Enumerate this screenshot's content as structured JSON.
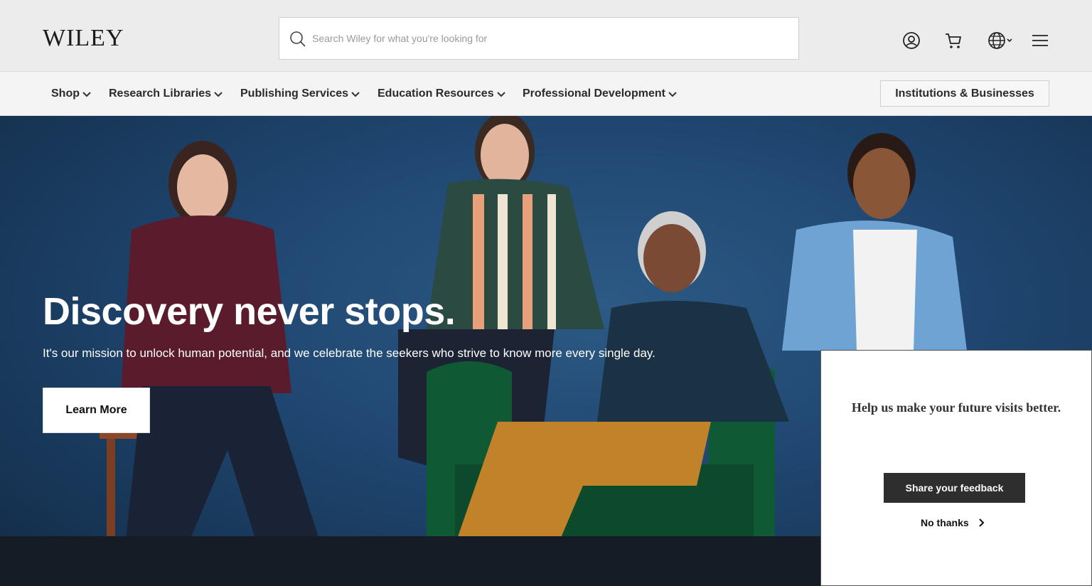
{
  "header": {
    "logo_text": "WILEY",
    "search": {
      "placeholder": "Search Wiley for what you're looking for",
      "value": ""
    },
    "icons": [
      "search-icon",
      "account-icon",
      "cart-icon",
      "globe-icon",
      "menu-icon"
    ]
  },
  "nav": {
    "items": [
      {
        "label": "Shop"
      },
      {
        "label": "Research Libraries"
      },
      {
        "label": "Publishing Services"
      },
      {
        "label": "Education Resources"
      },
      {
        "label": "Professional Development"
      }
    ],
    "institutions_button": "Institutions & Businesses"
  },
  "hero": {
    "title": "Discovery never stops.",
    "subtitle": "It's our mission to unlock human potential, and we celebrate the seekers who strive to know more every single day.",
    "cta": "Learn More"
  },
  "feedback": {
    "title": "Help us make your future visits better.",
    "share_button": "Share your feedback",
    "no_thanks": "No thanks"
  },
  "colors": {
    "header_bg": "#ececec",
    "nav_bg": "#f4f4f4",
    "hero_bg": "#1f4670",
    "feedback_button": "#2e2e2e"
  }
}
